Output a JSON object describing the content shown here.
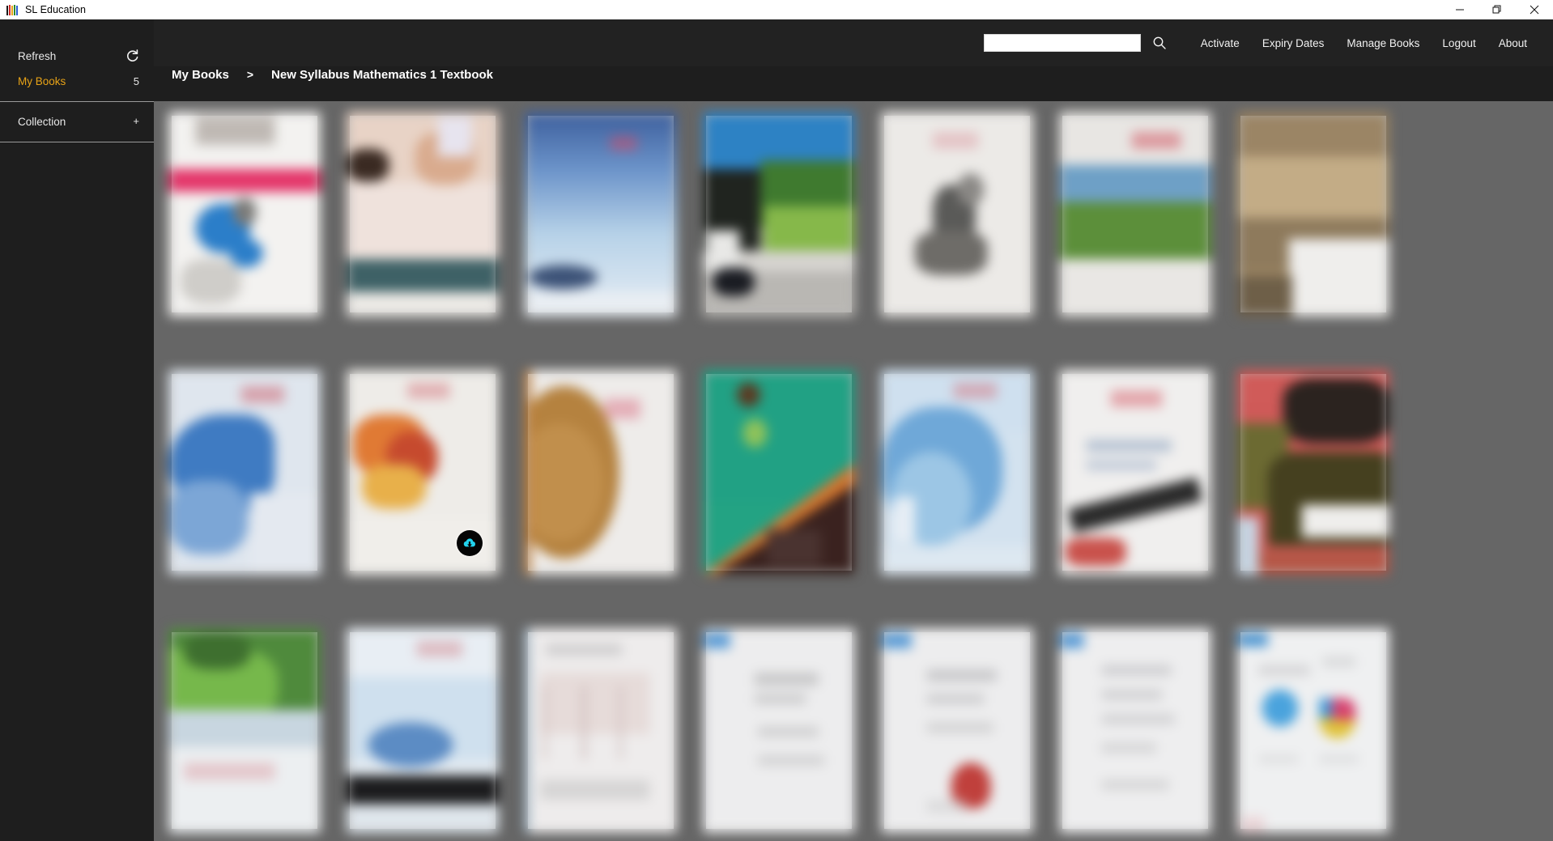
{
  "window": {
    "app_title": "SL Education",
    "app_icon": "books-icon",
    "controls": {
      "minimize": "minimize-icon",
      "maximize": "restore-icon",
      "close": "close-icon"
    }
  },
  "sidebar": {
    "items": [
      {
        "label": "Refresh",
        "value": "",
        "icon": "refresh-icon",
        "active": false
      },
      {
        "label": "My Books",
        "value": "5",
        "icon": "",
        "active": true
      },
      {
        "label": "Collection",
        "value": "",
        "icon": "plus-icon",
        "active": false
      }
    ]
  },
  "topbar": {
    "search": {
      "value": "",
      "placeholder": ""
    },
    "search_icon": "search-icon",
    "nav": [
      {
        "label": "Activate"
      },
      {
        "label": "Expiry Dates"
      },
      {
        "label": "Manage Books"
      },
      {
        "label": "Logout"
      },
      {
        "label": "About"
      }
    ]
  },
  "breadcrumb": {
    "root": "My Books",
    "separator": ">",
    "current": "New Syllabus Mathematics 1 Textbook"
  },
  "colors": {
    "accent": "#e8a317",
    "chrome_dark": "#1e1e1e",
    "topbar": "#222222",
    "content_bg": "#666666",
    "badge_cyan": "#22d3ee"
  },
  "pages": [
    {
      "index": 1,
      "badge": null
    },
    {
      "index": 2,
      "badge": null
    },
    {
      "index": 3,
      "badge": null
    },
    {
      "index": 4,
      "badge": null
    },
    {
      "index": 5,
      "badge": null
    },
    {
      "index": 6,
      "badge": null
    },
    {
      "index": 7,
      "badge": null
    },
    {
      "index": 8,
      "badge": null
    },
    {
      "index": 9,
      "badge": "cloud-download-icon"
    },
    {
      "index": 10,
      "badge": null
    },
    {
      "index": 11,
      "badge": null
    },
    {
      "index": 12,
      "badge": null
    },
    {
      "index": 13,
      "badge": null
    },
    {
      "index": 14,
      "badge": null
    },
    {
      "index": 15,
      "badge": null
    },
    {
      "index": 16,
      "badge": null
    },
    {
      "index": 17,
      "badge": null
    },
    {
      "index": 18,
      "badge": null
    },
    {
      "index": 19,
      "badge": null
    },
    {
      "index": 20,
      "badge": null
    },
    {
      "index": 21,
      "badge": null
    }
  ]
}
